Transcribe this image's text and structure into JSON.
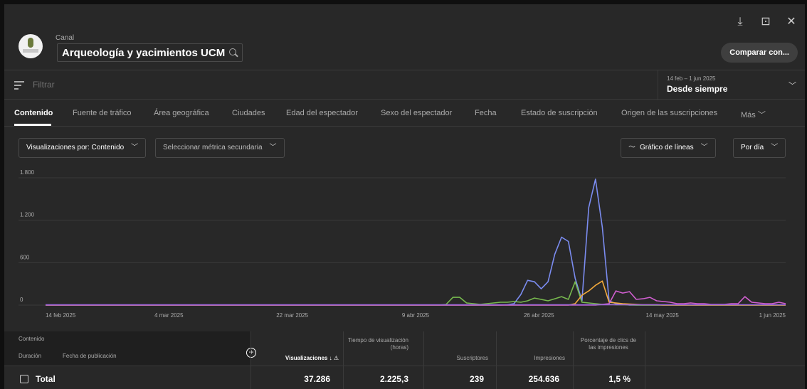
{
  "header": {
    "channel_label": "Canal",
    "channel_name": "Arqueología y yacimientos UCM",
    "compare_label": "Comparar con..."
  },
  "filter": {
    "placeholder": "Filtrar",
    "date_range": "14 feb – 1 jun 2025",
    "date_preset": "Desde siempre"
  },
  "tabs": [
    "Contenido",
    "Fuente de tráfico",
    "Área geográfica",
    "Ciudades",
    "Edad del espectador",
    "Sexo del espectador",
    "Fecha",
    "Estado de suscripción",
    "Origen de las suscripciones",
    "Más"
  ],
  "selectors": {
    "primary": "Visualizaciones por: Contenido",
    "secondary": "Seleccionar métrica secundaria",
    "chart_type": "Gráfico de líneas",
    "granularity": "Por día"
  },
  "chart_data": {
    "type": "line",
    "x": [
      "14 feb 2025",
      "4 mar 2025",
      "22 mar 2025",
      "9 abr 2025",
      "26 abr 2025",
      "14 may 2025",
      "1 jun 2025"
    ],
    "ylim": [
      0,
      1800
    ],
    "y_ticks": [
      "1.800",
      "1.200",
      "600",
      "0"
    ],
    "series": [
      {
        "color": "#7b8cf0",
        "values": [
          0,
          0,
          0,
          0,
          0,
          0,
          0,
          0,
          0,
          0,
          0,
          0,
          0,
          0,
          0,
          0,
          0,
          0,
          0,
          0,
          0,
          0,
          0,
          0,
          0,
          0,
          0,
          0,
          0,
          0,
          0,
          0,
          0,
          0,
          0,
          0,
          0,
          0,
          0,
          0,
          0,
          0,
          0,
          0,
          0,
          0,
          0,
          0,
          0,
          0,
          0,
          0,
          0,
          0,
          0,
          0,
          0,
          0,
          0,
          0,
          0,
          0,
          0,
          0,
          0,
          0,
          0,
          0,
          5,
          20,
          150,
          350,
          330,
          230,
          330,
          720,
          960,
          900,
          380,
          60,
          1380,
          1780,
          1100,
          60,
          20,
          10,
          0,
          0,
          0,
          0,
          0,
          0,
          0,
          0,
          0,
          0,
          0,
          0,
          0,
          0,
          0,
          0,
          0,
          0,
          0,
          0,
          0,
          0,
          0,
          0
        ]
      },
      {
        "color": "#77b94e",
        "values": [
          0,
          0,
          0,
          0,
          0,
          0,
          0,
          0,
          0,
          0,
          0,
          0,
          0,
          0,
          0,
          0,
          0,
          0,
          0,
          0,
          0,
          0,
          0,
          0,
          0,
          0,
          0,
          0,
          0,
          0,
          0,
          0,
          0,
          0,
          0,
          0,
          0,
          0,
          0,
          0,
          0,
          0,
          0,
          0,
          0,
          0,
          0,
          0,
          0,
          0,
          0,
          0,
          0,
          0,
          0,
          0,
          0,
          0,
          0,
          10,
          110,
          110,
          30,
          20,
          10,
          20,
          30,
          40,
          40,
          50,
          40,
          60,
          100,
          80,
          60,
          90,
          120,
          80,
          330,
          40,
          30,
          20,
          10,
          10,
          5,
          5,
          5,
          0,
          0,
          0,
          0,
          0,
          0,
          0,
          0,
          0,
          0,
          0,
          0,
          0,
          0,
          0,
          0,
          0,
          0,
          0,
          0,
          0,
          0,
          0
        ]
      },
      {
        "color": "#f2a93b",
        "values": [
          0,
          0,
          0,
          0,
          0,
          0,
          0,
          0,
          0,
          0,
          0,
          0,
          0,
          0,
          0,
          0,
          0,
          0,
          0,
          0,
          0,
          0,
          0,
          0,
          0,
          0,
          0,
          0,
          0,
          0,
          0,
          0,
          0,
          0,
          0,
          0,
          0,
          0,
          0,
          0,
          0,
          0,
          0,
          0,
          0,
          0,
          0,
          0,
          0,
          0,
          0,
          0,
          0,
          0,
          0,
          0,
          0,
          0,
          0,
          0,
          0,
          0,
          0,
          0,
          0,
          0,
          0,
          0,
          0,
          0,
          0,
          0,
          0,
          0,
          0,
          0,
          0,
          0,
          20,
          140,
          200,
          280,
          340,
          40,
          30,
          20,
          15,
          10,
          5,
          5,
          5,
          0,
          0,
          0,
          0,
          0,
          0,
          0,
          0,
          0,
          0,
          0,
          0,
          0,
          0,
          0,
          0,
          0,
          0,
          0
        ]
      },
      {
        "color": "#d05fd0",
        "values": [
          0,
          0,
          0,
          0,
          0,
          0,
          0,
          0,
          0,
          0,
          0,
          0,
          0,
          0,
          0,
          0,
          0,
          0,
          0,
          0,
          0,
          0,
          0,
          0,
          0,
          0,
          0,
          0,
          0,
          0,
          0,
          0,
          0,
          0,
          0,
          0,
          0,
          0,
          0,
          0,
          0,
          0,
          0,
          0,
          0,
          0,
          0,
          0,
          0,
          0,
          0,
          0,
          0,
          0,
          0,
          0,
          0,
          0,
          0,
          0,
          0,
          0,
          0,
          0,
          0,
          0,
          0,
          0,
          0,
          0,
          0,
          0,
          0,
          0,
          0,
          0,
          0,
          0,
          0,
          0,
          0,
          0,
          10,
          20,
          200,
          170,
          190,
          80,
          90,
          110,
          60,
          50,
          40,
          20,
          20,
          30,
          20,
          20,
          10,
          10,
          10,
          20,
          20,
          120,
          40,
          30,
          20,
          20,
          40,
          20
        ]
      },
      {
        "color": "#9a64d8",
        "values": [
          5,
          5,
          5,
          5,
          5,
          5,
          5,
          5,
          5,
          5,
          5,
          5,
          5,
          5,
          5,
          5,
          5,
          5,
          5,
          5,
          5,
          5,
          5,
          5,
          5,
          5,
          5,
          5,
          5,
          5,
          5,
          5,
          5,
          5,
          5,
          5,
          5,
          5,
          5,
          5,
          5,
          5,
          5,
          5,
          5,
          5,
          5,
          5,
          5,
          5,
          5,
          5,
          5,
          5,
          5,
          5,
          5,
          5,
          5,
          5,
          5,
          5,
          5,
          5,
          5,
          5,
          5,
          5,
          5,
          5,
          5,
          5,
          5,
          5,
          5,
          5,
          5,
          5,
          5,
          5,
          5,
          5,
          5,
          5,
          5,
          5,
          5,
          5,
          5,
          5,
          5,
          5,
          5,
          5,
          5,
          5,
          5,
          5,
          5,
          5,
          5,
          5,
          5,
          5,
          5,
          5,
          5,
          5,
          5,
          5
        ]
      }
    ]
  },
  "table": {
    "col_content": "Contenido",
    "col_duration": "Duración",
    "col_published": "Fecha de publicación",
    "col_views": "Visualizaciones",
    "col_watch": "Tiempo de visualización (horas)",
    "col_subs": "Suscriptores",
    "col_impr": "Impresiones",
    "col_ctr": "Porcentaje de clics de las impresiones",
    "total_label": "Total",
    "total_views": "37.286",
    "total_watch": "2.225,3",
    "total_subs": "239",
    "total_impr": "254.636",
    "total_ctr": "1,5 %"
  }
}
